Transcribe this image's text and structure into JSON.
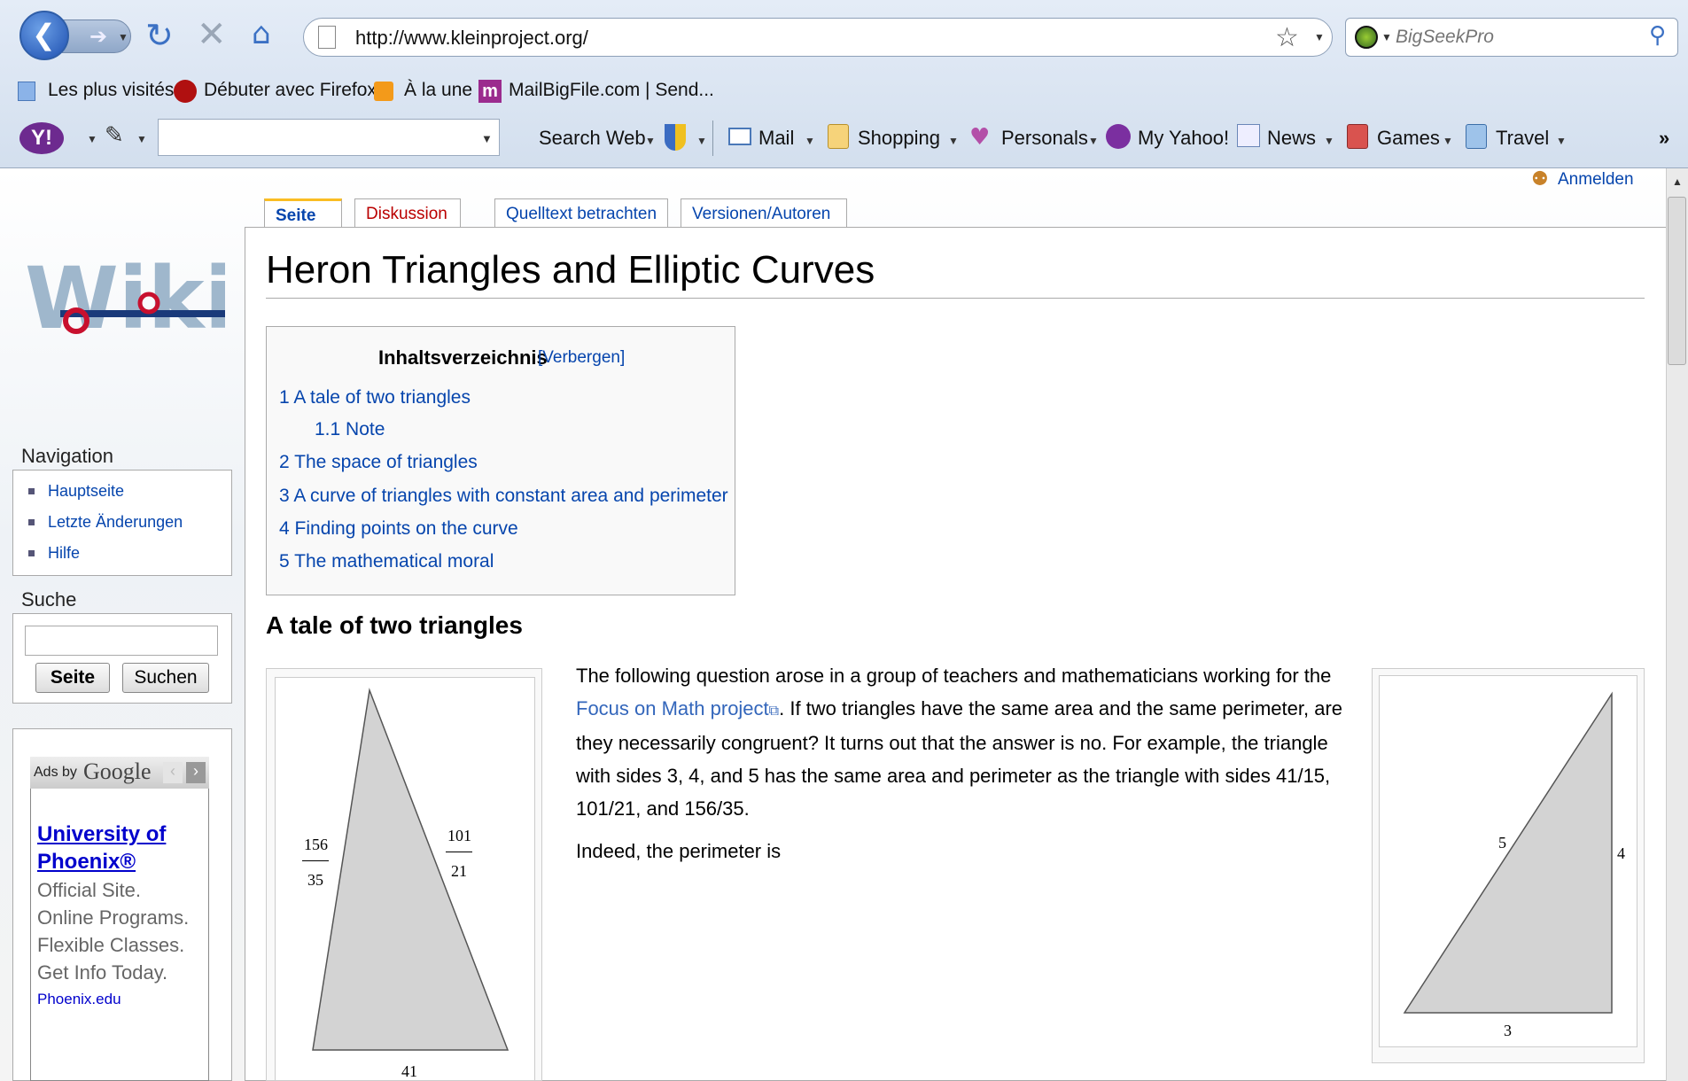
{
  "browser": {
    "url": "http://www.kleinproject.org/",
    "search_engine_placeholder": "BigSeekPro",
    "bookmarks": [
      "Les plus visités",
      "Débuter avec Firefox",
      "À la une",
      "MailBigFile.com | Send..."
    ],
    "yahoo_toolbar": {
      "search_label": "Search Web",
      "items": [
        "Mail",
        "Shopping",
        "Personals",
        "My Yahoo!",
        "News",
        "Games",
        "Travel"
      ],
      "overflow": "»"
    }
  },
  "wiki": {
    "login": "Anmelden",
    "tabs": [
      "Seite",
      "Diskussion",
      "Quelltext betrachten",
      "Versionen/Autoren"
    ],
    "nav_heading": "Navigation",
    "nav_items": [
      "Hauptseite",
      "Letzte Änderungen",
      "Hilfe"
    ],
    "search_heading": "Suche",
    "search_go": "Seite",
    "search_button": "Suchen",
    "ad": {
      "label": "Ads by",
      "brand": "Google",
      "title": "University of Phoenix®",
      "lines": [
        "Official Site.",
        "Online Programs.",
        "Flexible Classes.",
        "Get Info Today."
      ],
      "url": "Phoenix.edu"
    }
  },
  "article": {
    "title": "Heron Triangles and Elliptic Curves",
    "toc_title": "Inhaltsverzeichnis",
    "toc_toggle": "[Verbergen]",
    "toc": [
      {
        "num": "1",
        "text": "A tale of two triangles"
      },
      {
        "num": "1.1",
        "text": "Note"
      },
      {
        "num": "2",
        "text": "The space of triangles"
      },
      {
        "num": "3",
        "text": "A curve of triangles with constant area and perimeter"
      },
      {
        "num": "4",
        "text": "Finding points on the curve"
      },
      {
        "num": "5",
        "text": "The mathematical moral"
      }
    ],
    "section1_title": "A tale of two triangles",
    "para1_before_link": "The following question arose in a group of teachers and mathematicians working for the",
    "para1_link": "Focus on Math project",
    "para1_after_link": ". If two triangles have the same area and the same perimeter, are they necessarily congruent? It turns out that the answer is no. For example, the triangle with sides 3, 4, and 5 has the same area and perimeter as the triangle with sides 41/15, 101/21, and 156/35.",
    "para2": "Indeed, the perimeter is",
    "triangle_left": {
      "left_num": "156",
      "left_den": "35",
      "right_num": "101",
      "right_den": "21",
      "bottom": "41"
    },
    "triangle_right": {
      "hyp": "5",
      "vertical": "4",
      "bottom": "3"
    }
  }
}
